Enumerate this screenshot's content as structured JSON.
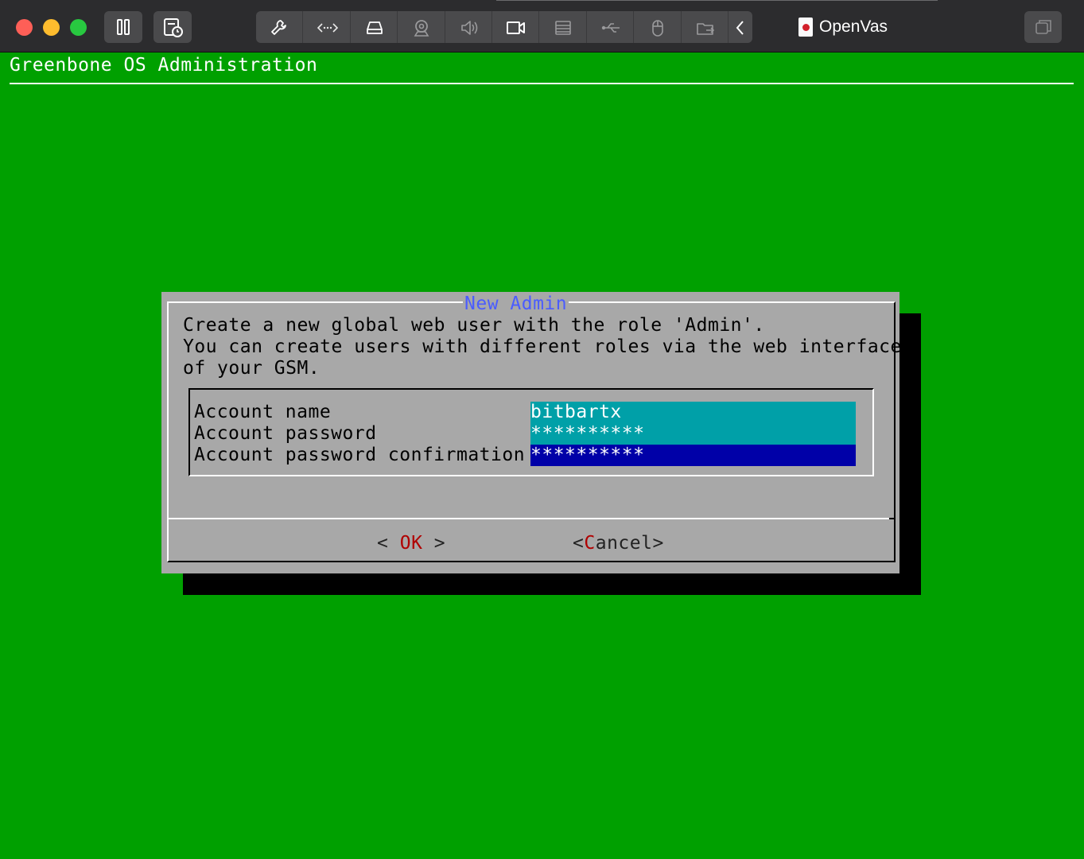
{
  "window": {
    "title": "OpenVas",
    "toolbar_icons": [
      "pause-icon",
      "snapshot-icon",
      "wrench-icon",
      "network-icon",
      "harddisk-icon",
      "webcam-icon",
      "sound-icon",
      "camera-icon",
      "printer-icon",
      "usb-icon",
      "mouse-icon",
      "shared-folder-icon",
      "chevron-left-icon"
    ],
    "colors": {
      "screen_bg": "#00a000",
      "dialog_bg": "#a8a8a8",
      "title_color": "#4a5cff",
      "hotkey_color": "#b00000"
    }
  },
  "screen": {
    "os_title": "Greenbone OS Administration",
    "dialog": {
      "title": "New Admin",
      "description_lines": [
        "Create a new global web user with the role 'Admin'.",
        "You can create users with different roles via the web interface",
        "of your GSM."
      ],
      "fields": [
        {
          "label": "Account name",
          "value": "bitbartx"
        },
        {
          "label": "Account password",
          "value": "**********"
        },
        {
          "label": "Account password confirmation",
          "value": "**********"
        }
      ],
      "buttons": {
        "ok": {
          "left": "<",
          "pre": " ",
          "hot": "O",
          "rest": "K",
          "post": " ",
          "right": ">"
        },
        "cancel": {
          "left": "<",
          "hot": "C",
          "rest": "ancel",
          "right": ">"
        }
      }
    }
  }
}
